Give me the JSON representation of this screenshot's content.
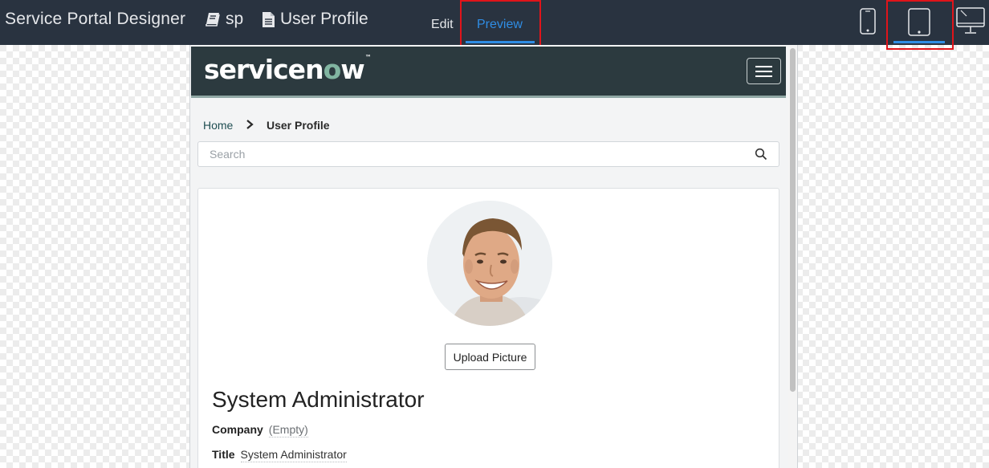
{
  "app": {
    "title": "Service Portal Designer",
    "portal_name": "sp",
    "page_name": "User Profile"
  },
  "tabs": [
    {
      "label": "Edit",
      "active": false
    },
    {
      "label": "Preview",
      "active": true
    }
  ],
  "device_modes": [
    {
      "name": "phone",
      "active": false
    },
    {
      "name": "tablet",
      "active": true
    },
    {
      "name": "desktop",
      "active": false
    }
  ],
  "colors": {
    "topbar": "#293340",
    "accent": "#2f8de4",
    "highlight": "#e0141a",
    "portal_header": "#2c3a3f",
    "portal_logo_accent": "#81b5a1"
  },
  "portal": {
    "logo": {
      "part1": "servicen",
      "o": "o",
      "part2": "w",
      "tm": "™"
    },
    "menu_icon": "hamburger-icon",
    "breadcrumb": {
      "home": "Home",
      "current": "User Profile"
    },
    "search": {
      "placeholder": "Search",
      "value": ""
    },
    "profile": {
      "upload_label": "Upload Picture",
      "name": "System Administrator",
      "fields": [
        {
          "label": "Company",
          "value": "(Empty)"
        },
        {
          "label": "Title",
          "value": "System Administrator"
        }
      ]
    }
  }
}
